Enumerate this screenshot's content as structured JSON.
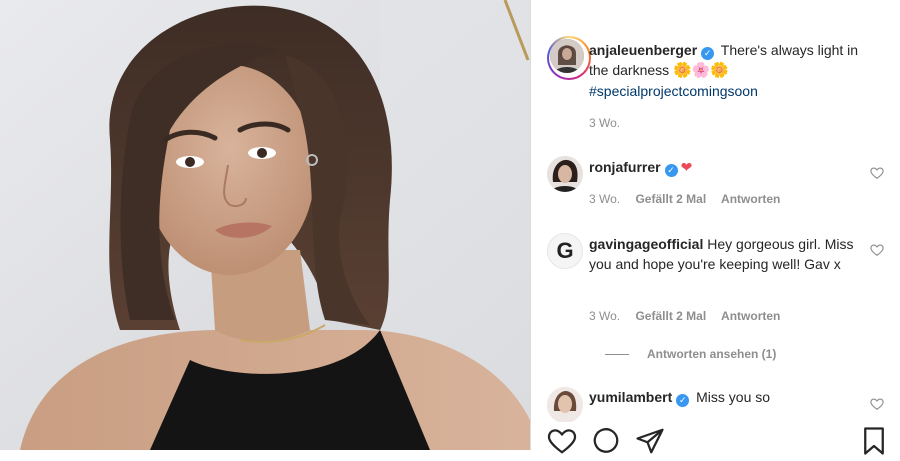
{
  "post": {
    "author": {
      "username": "anjaleuenberger",
      "verified": true
    },
    "caption": "There's always light in the darkness",
    "caption_emojis": "🌼🌸🌼",
    "hashtag": "#specialprojectcomingsoon",
    "time": "3 Wo."
  },
  "comments": [
    {
      "username": "ronjafurrer",
      "verified": true,
      "extra_emoji": "❤",
      "text": "",
      "time": "3 Wo.",
      "likes": "Gefällt 2 Mal",
      "reply": "Antworten"
    },
    {
      "username": "gavingageofficial",
      "avatar_letter": "G",
      "verified": false,
      "text": "Hey gorgeous girl. Miss you and hope you're keeping well! Gav x",
      "time": "3 Wo.",
      "likes": "Gefällt 2 Mal",
      "reply": "Antworten",
      "view_replies": "Antworten ansehen (1)"
    },
    {
      "username": "yumilambert",
      "verified": true,
      "text": "Miss you so"
    }
  ],
  "icons": {
    "like": "heart-icon",
    "comment": "comment-icon",
    "share": "share-icon",
    "save": "bookmark-icon",
    "comment_like": "heart-icon",
    "verified": "verified-badge-icon"
  },
  "colors": {
    "verified": "#3897f0",
    "hashtag": "#00376b",
    "meta": "#8e8e8e"
  }
}
